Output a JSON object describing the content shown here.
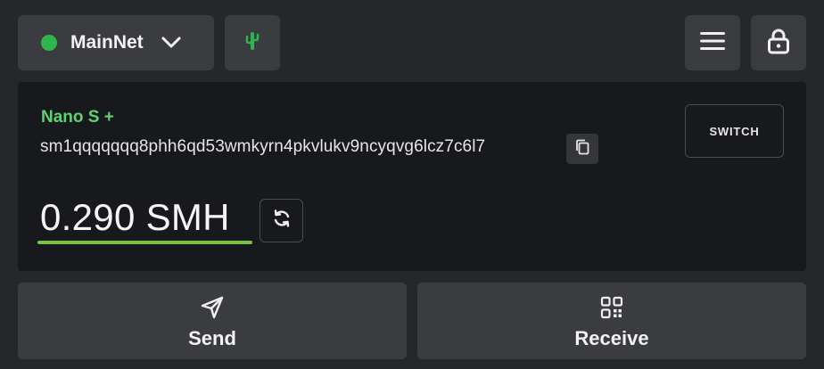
{
  "header": {
    "network_label": "MainNet",
    "network_status_color": "#2fb64a",
    "icons": [
      "chevron-down-icon",
      "cactus-icon",
      "hamburger-menu-icon",
      "lock-icon"
    ]
  },
  "wallet": {
    "device_name": "Nano S +",
    "address": "sm1qqqqqqq8phh6qd53wmkyrn4pkvlukv9ncyqvg6lcz7c6l7",
    "switch_label": "SWITCH",
    "balance": "0.290 SMH",
    "accent_color": "#5ed272"
  },
  "actions": {
    "send_label": "Send",
    "receive_label": "Receive"
  }
}
